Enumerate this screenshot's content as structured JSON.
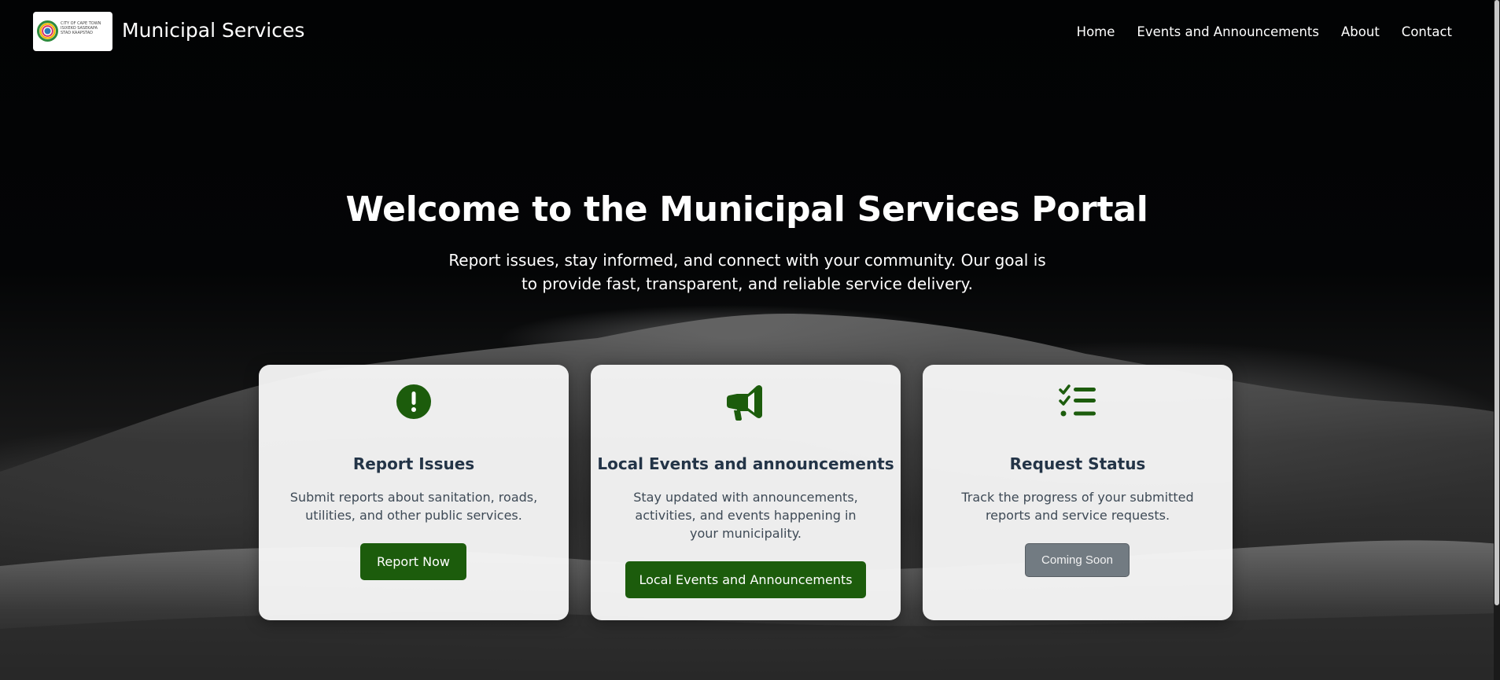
{
  "header": {
    "logo_text_lines": [
      "CITY OF CAPE TOWN",
      "ISIXEKO SASEKAPA",
      "STAD KAAPSTAD"
    ],
    "site_title": "Municipal Services",
    "nav": [
      {
        "label": "Home"
      },
      {
        "label": "Events and Announcements"
      },
      {
        "label": "About"
      },
      {
        "label": "Contact"
      }
    ]
  },
  "hero": {
    "title": "Welcome to the Municipal Services Portal",
    "subtitle": "Report issues, stay informed, and connect with your community. Our goal is to provide fast, transparent, and reliable service delivery."
  },
  "cards": [
    {
      "icon": "exclamation-circle-icon",
      "title": "Report Issues",
      "description": "Submit reports about sanitation, roads, utilities, and other public services.",
      "button_label": "Report Now"
    },
    {
      "icon": "megaphone-icon",
      "title": "Local Events and announcements",
      "description": "Stay updated with announcements, activities, and events happening in your municipality.",
      "button_label": "Local Events and Announcements"
    },
    {
      "icon": "checklist-icon",
      "title": "Request Status",
      "description": "Track the progress of your submitted reports and service requests.",
      "button_label": "Coming Soon"
    }
  ],
  "colors": {
    "primary_green": "#1c5c0c",
    "disabled_gray": "#6c757d",
    "card_title": "#233447",
    "card_text": "#3e4a56"
  }
}
